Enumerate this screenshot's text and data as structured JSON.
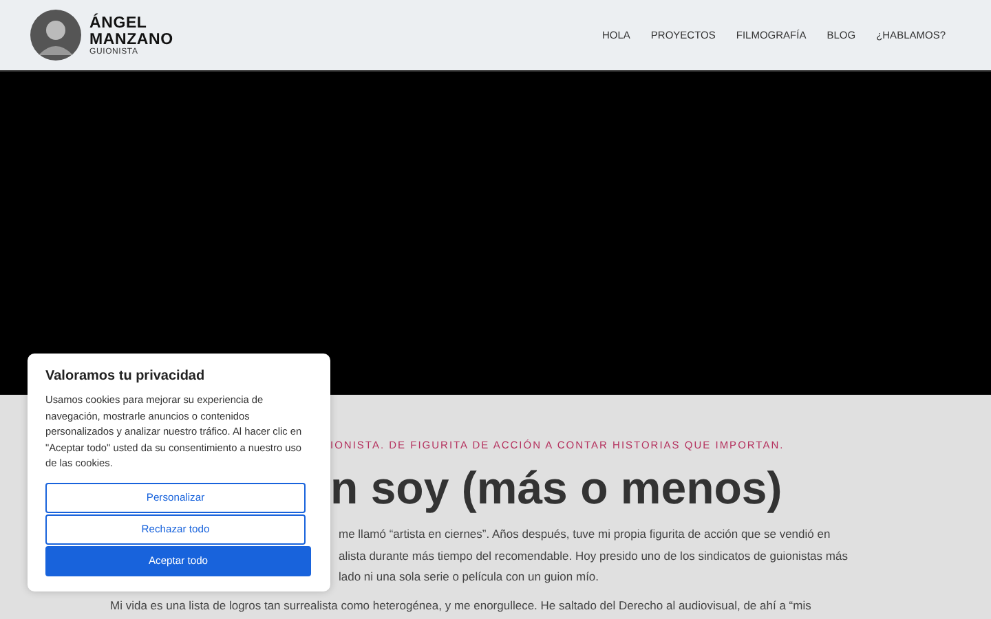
{
  "header": {
    "name": "ÁNGEL\nMANZANO",
    "role": "GUIONISTA",
    "nav": [
      "HOLA",
      "PROYECTOS",
      "FILMOGRAFÍA",
      "BLOG",
      "¿HABLAMOS?"
    ]
  },
  "intro": {
    "kicker": "IONISTA. DE FIGURITA DE ACCIÓN A CONTAR HISTORIAS QUE IMPORTAN.",
    "heading": "n soy (más o menos)",
    "lines": [
      "me llamó “artista en ciernes”. Años después, tuve mi propia figurita de acción que se vendió en",
      "alista durante más tiempo del recomendable. Hoy presido uno de los sindicatos de guionistas más",
      "lado ni una sola serie o película con un guion mío."
    ],
    "paragraph_2": "Mi vida es una lista de logros tan surrealista como heterogénea, y me enorgullece. He saltado del Derecho al audiovisual, de ahí a “mis"
  },
  "cookie_banner": {
    "title": "Valoramos tu privacidad",
    "text": "Usamos cookies para mejorar su experiencia de navegación, mostrarle anuncios o contenidos personalizados y analizar nuestro tráfico. Al hacer clic en \"Aceptar todo\" usted da su consentimiento a nuestro uso de las cookies.",
    "buttons": [
      {
        "label": "Personalizar",
        "kind": "outline"
      },
      {
        "label": "Rechazar todo",
        "kind": "outline"
      },
      {
        "label": "Aceptar todo",
        "kind": "primary"
      }
    ]
  }
}
